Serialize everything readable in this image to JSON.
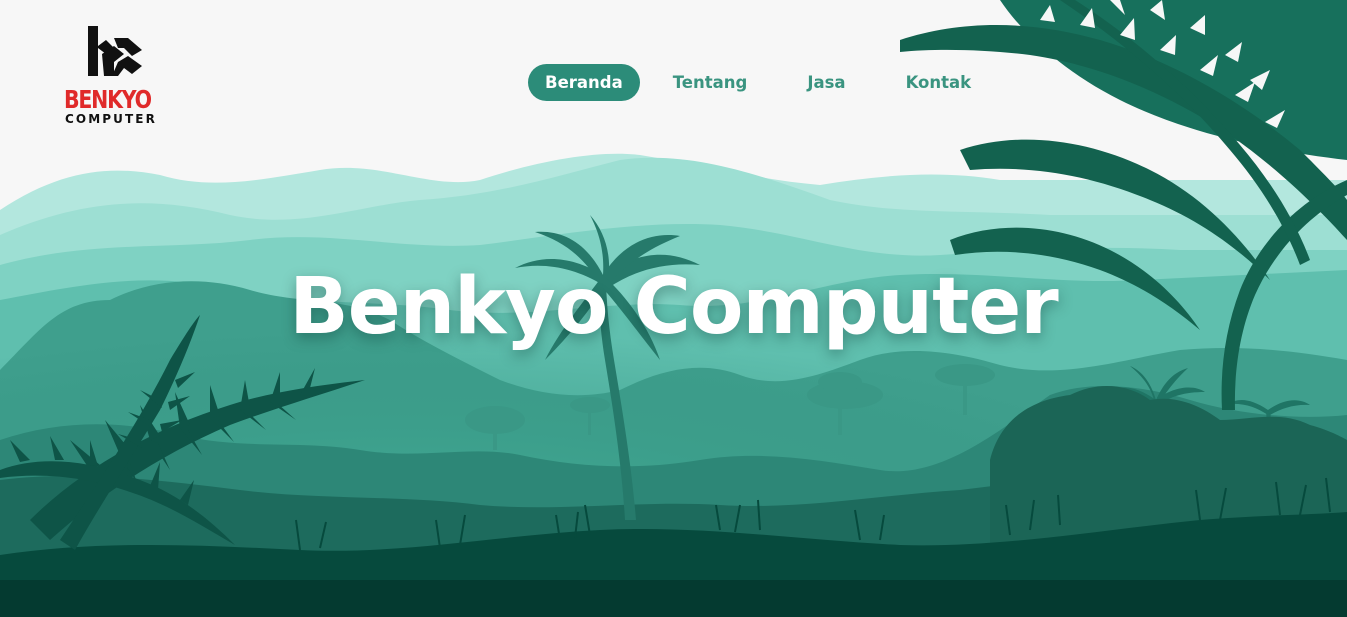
{
  "logo": {
    "brand": "BENKYO",
    "sub": "COMPUTER",
    "icon": "bc-monogram-icon"
  },
  "nav": {
    "items": [
      {
        "label": "Beranda",
        "active": true
      },
      {
        "label": "Tentang",
        "active": false
      },
      {
        "label": "Jasa",
        "active": false
      },
      {
        "label": "Kontak",
        "active": false
      }
    ]
  },
  "hero": {
    "title": "Benkyo Computer"
  },
  "colors": {
    "accent": "#2c8c79",
    "nav_text": "#3a9480",
    "brand_red": "#e02a2a",
    "background": "#f7f7f7",
    "ground": "#043a30"
  }
}
